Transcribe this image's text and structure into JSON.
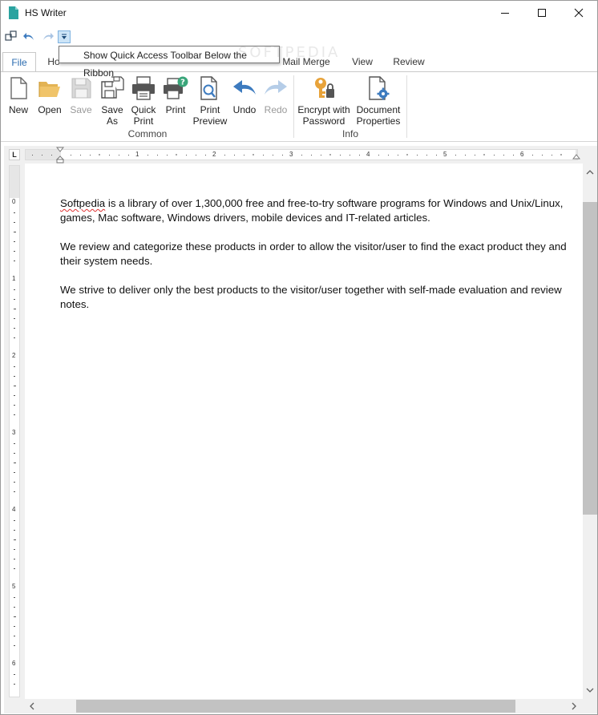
{
  "window": {
    "title": "HS Writer"
  },
  "qat": {
    "tooltip": "Show Quick Access Toolbar Below the Ribbon"
  },
  "watermark": "SOFTPEDIA",
  "tabs": [
    {
      "label": "File"
    },
    {
      "label": "Ho"
    },
    {
      "label": "Mail Merge"
    },
    {
      "label": "View"
    },
    {
      "label": "Review"
    }
  ],
  "ribbon": {
    "common": {
      "label": "Common",
      "new": "New",
      "open": "Open",
      "save": "Save",
      "save_as": [
        "Save",
        "As"
      ],
      "quick_print": [
        "Quick",
        "Print"
      ],
      "print": "Print",
      "print_preview": [
        "Print",
        "Preview"
      ],
      "undo": "Undo",
      "redo": "Redo"
    },
    "info": {
      "label": "Info",
      "encrypt": [
        "Encrypt with",
        "Password"
      ],
      "doc_props": [
        "Document",
        "Properties"
      ]
    }
  },
  "ruler": {
    "corner": "L",
    "h_labels": [
      "1",
      "2",
      "3",
      "4",
      "5",
      "6"
    ],
    "v_labels": [
      "0",
      "1",
      "2",
      "3",
      "4",
      "5",
      "6"
    ]
  },
  "document": {
    "para1_spell": "Softpedia",
    "para1_rest": " is a library of over 1,300,000 free and free-to-try software programs for Windows and Unix/Linux, games, Mac software, Windows drivers, mobile devices and IT-related articles.",
    "para2": "We review and categorize these products in order to allow the visitor/user to find the exact product they and their system needs.",
    "para3": "We strive to deliver only the best products to the visitor/user together with self-made evaluation and review notes."
  },
  "colors": {
    "accent": "#2b6cb0",
    "icon_blue": "#3d7bbf",
    "icon_teal": "#2aa3a0",
    "key_gold": "#e8a33a"
  }
}
